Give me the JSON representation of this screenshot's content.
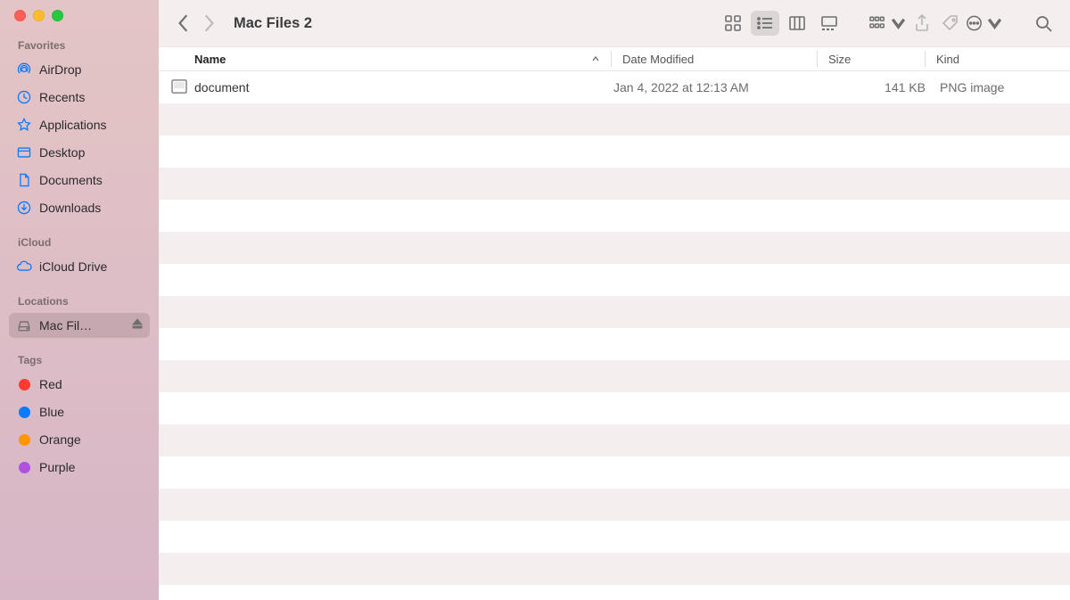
{
  "window_title": "Mac Files 2",
  "sidebar": {
    "sections": [
      {
        "title": "Favorites",
        "items": [
          {
            "icon": "airdrop",
            "label": "AirDrop"
          },
          {
            "icon": "recents",
            "label": "Recents"
          },
          {
            "icon": "applications",
            "label": "Applications"
          },
          {
            "icon": "desktop",
            "label": "Desktop"
          },
          {
            "icon": "documents",
            "label": "Documents"
          },
          {
            "icon": "downloads",
            "label": "Downloads"
          }
        ]
      },
      {
        "title": "iCloud",
        "items": [
          {
            "icon": "icloud",
            "label": "iCloud Drive"
          }
        ]
      },
      {
        "title": "Locations",
        "items": [
          {
            "icon": "disk",
            "label": "Mac Fil…",
            "selected": true,
            "ejectable": true
          }
        ]
      },
      {
        "title": "Tags",
        "items": [
          {
            "icon": "tag",
            "color": "red",
            "label": "Red"
          },
          {
            "icon": "tag",
            "color": "blue",
            "label": "Blue"
          },
          {
            "icon": "tag",
            "color": "orange",
            "label": "Orange"
          },
          {
            "icon": "tag",
            "color": "purple",
            "label": "Purple"
          }
        ]
      }
    ]
  },
  "columns": {
    "name": "Name",
    "date": "Date Modified",
    "size": "Size",
    "kind": "Kind"
  },
  "files": [
    {
      "name": "document",
      "date": "Jan 4, 2022 at 12:13 AM",
      "size": "141 KB",
      "kind": "PNG image"
    }
  ],
  "stripe_rows": 16
}
